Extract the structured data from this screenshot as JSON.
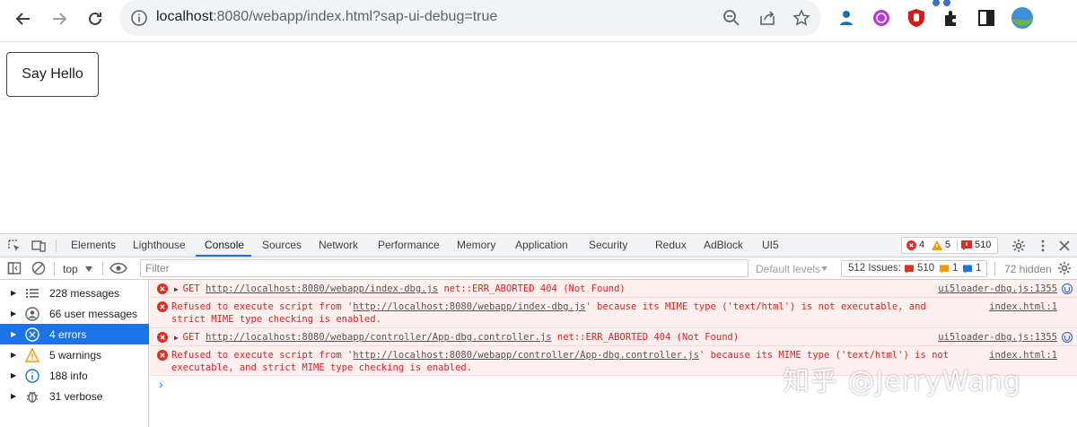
{
  "browser": {
    "url_host": "localhost",
    "url_rest": ":8080/webapp/index.html?sap-ui-debug=true"
  },
  "page": {
    "say_hello_label": "Say Hello"
  },
  "devtools": {
    "tabs": [
      "Elements",
      "Lighthouse",
      "Console",
      "Sources",
      "Network",
      "Performance",
      "Memory",
      "Application",
      "Security",
      "Redux",
      "AdBlock",
      "UI5"
    ],
    "active_tab": "Console",
    "badge": {
      "errors": "4",
      "warnings": "5",
      "issues": "510"
    },
    "context": "top",
    "filter_placeholder": "Filter",
    "default_levels": "Default levels",
    "issues_label": "512 Issues:",
    "issues_counts": {
      "errors": "510",
      "warnings": "1",
      "info": "1"
    },
    "hidden": "72 hidden",
    "sidebar": [
      {
        "label": "228 messages",
        "icon": "list-icon"
      },
      {
        "label": "66 user messages",
        "icon": "user-icon"
      },
      {
        "label": "4 errors",
        "icon": "error-icon",
        "active": true
      },
      {
        "label": "5 warnings",
        "icon": "warning-icon"
      },
      {
        "label": "188 info",
        "icon": "info-icon"
      },
      {
        "label": "31 verbose",
        "icon": "bug-icon"
      }
    ],
    "messages": [
      {
        "prefix": "GET ",
        "url": "http://localhost:8080/webapp/index-dbg.js",
        "suffix": " net::ERR_ABORTED 404 (Not Found)",
        "source": "ui5loader-dbg.js:1355"
      },
      {
        "line1_pre": "Refused to execute script from '",
        "url": "http://localhost:8080/webapp/index-dbg.js",
        "line1_post": "' because its MIME type ('text/html') is not executable, and",
        "line2": "strict MIME type checking is enabled.",
        "source": "index.html:1"
      },
      {
        "prefix": "GET ",
        "url": "http://localhost:8080/webapp/controller/App-dbg.controller.js",
        "suffix": " net::ERR_ABORTED 404 (Not Found)",
        "source": "ui5loader-dbg.js:1355"
      },
      {
        "line1_pre": "Refused to execute script from '",
        "url": "http://localhost:8080/webapp/controller/App-dbg.controller.js",
        "line1_post": "' because its MIME type ('text/html') is not",
        "line2": "executable, and strict MIME type checking is enabled.",
        "source": "index.html:1"
      }
    ]
  },
  "watermark": "知乎 @JerryWang"
}
